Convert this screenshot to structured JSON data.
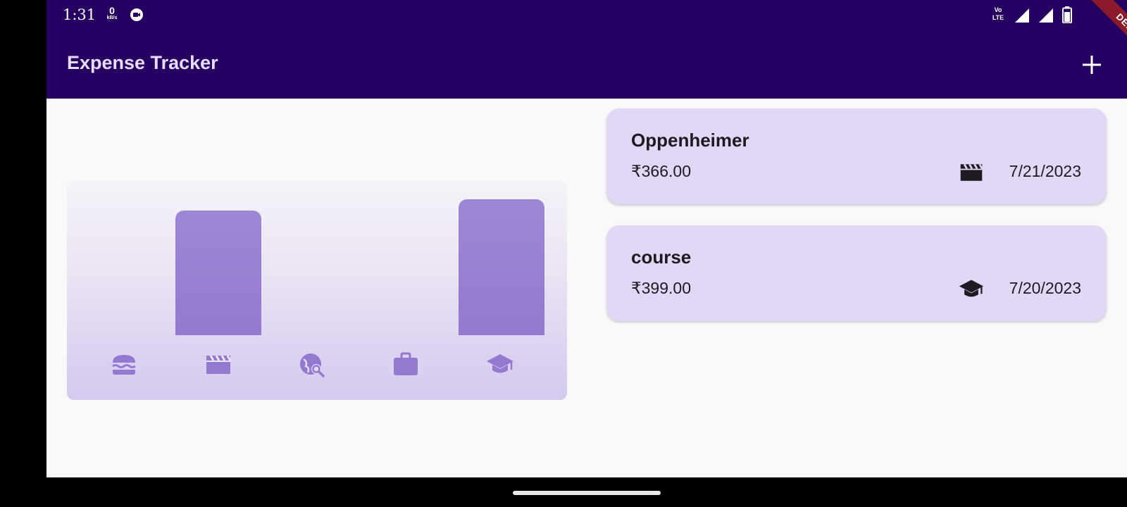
{
  "status_bar": {
    "time": "1:31",
    "net_speed_value": "0",
    "net_speed_unit": "kB/s",
    "volte_line1": "Vo",
    "volte_line2": "LTE"
  },
  "app_bar": {
    "title": "Expense Tracker",
    "add_icon": "plus-icon",
    "debug_banner": "DEBUG"
  },
  "chart": {
    "categories": [
      {
        "name": "food",
        "icon": "burger-icon",
        "value": 0
      },
      {
        "name": "leisure",
        "icon": "movie-clapper-icon",
        "value": 366
      },
      {
        "name": "travel",
        "icon": "travel-explore-icon",
        "value": 0
      },
      {
        "name": "work",
        "icon": "briefcase-icon",
        "value": 0
      },
      {
        "name": "education",
        "icon": "graduation-cap-icon",
        "value": 399
      }
    ],
    "max_value": 399,
    "bar_color": "#9479d0"
  },
  "expenses": [
    {
      "title": "Oppenheimer",
      "amount": "₹366.00",
      "category_icon": "movie-clapper-icon",
      "date": "7/21/2023"
    },
    {
      "title": "course",
      "amount": "₹399.00",
      "category_icon": "graduation-cap-icon",
      "date": "7/20/2023"
    }
  ],
  "colors": {
    "app_bar": "#260060",
    "card": "#e2d7f5",
    "background": "#f9f9f9"
  }
}
